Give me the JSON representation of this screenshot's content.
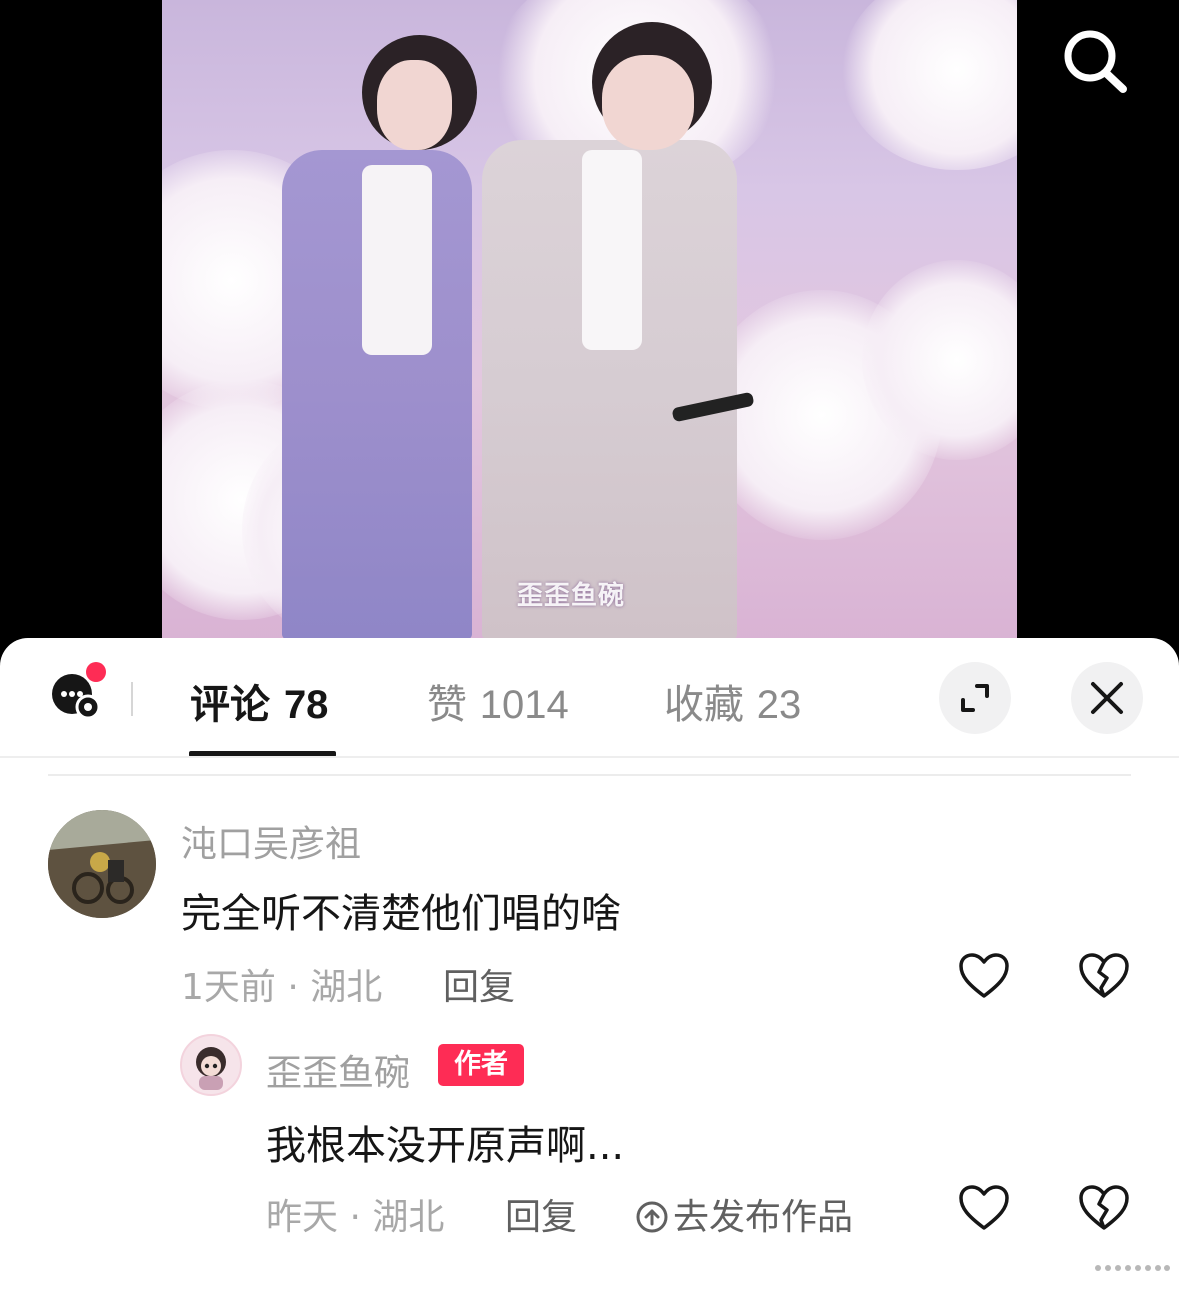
{
  "video": {
    "watermark": "歪歪鱼碗",
    "search_icon": "search-icon"
  },
  "tabs": {
    "comments_label": "评论",
    "comments_count": "78",
    "likes_label": "赞",
    "likes_count": "1014",
    "favorites_label": "收藏",
    "favorites_count": "23",
    "expand_icon": "expand-icon",
    "close_icon": "close-icon",
    "chat_icon": "chat-settings-icon"
  },
  "comments": [
    {
      "username": "沌口吴彦祖",
      "text": "完全听不清楚他们唱的啥",
      "meta": "1天前 · 湖北",
      "reply_label": "回复"
    },
    {
      "username": "歪歪鱼碗",
      "badge": "作者",
      "text": "我根本没开原声啊...",
      "meta": "昨天 · 湖北",
      "reply_label": "回复",
      "publish_label": "去发布作品"
    }
  ],
  "colors": {
    "accent": "#fe2c55",
    "text_primary": "#161616",
    "text_secondary": "#a0a0a0"
  }
}
